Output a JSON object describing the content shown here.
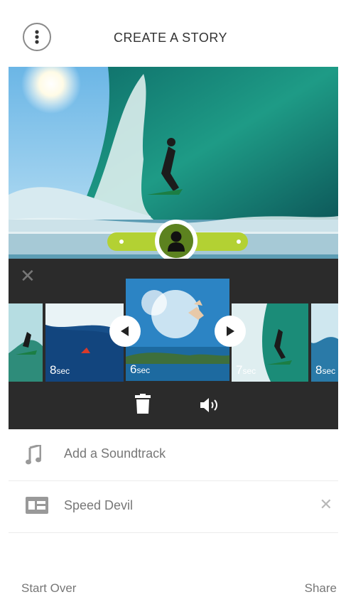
{
  "header": {
    "title": "CREATE A STORY",
    "menu_icon": "more-vertical-icon"
  },
  "preview": {
    "trim_colors": {
      "accent": "#b3d133",
      "avatar_bg": "#5c821f"
    }
  },
  "editor": {
    "close_icon": "close-icon",
    "clips": [
      {
        "number": "",
        "unit": ""
      },
      {
        "number": "8",
        "unit": "sec"
      },
      {
        "number": "6",
        "unit": "sec"
      },
      {
        "number": "7",
        "unit": "sec"
      },
      {
        "number": "8",
        "unit": "sec"
      }
    ],
    "tools": {
      "delete_icon": "trash-icon",
      "audio_icon": "volume-icon"
    }
  },
  "options": {
    "soundtrack_label": "Add a Soundtrack",
    "theme_label": "Speed Devil",
    "clear_glyph": "✕"
  },
  "footer": {
    "start_over": "Start Over",
    "share": "Share"
  }
}
